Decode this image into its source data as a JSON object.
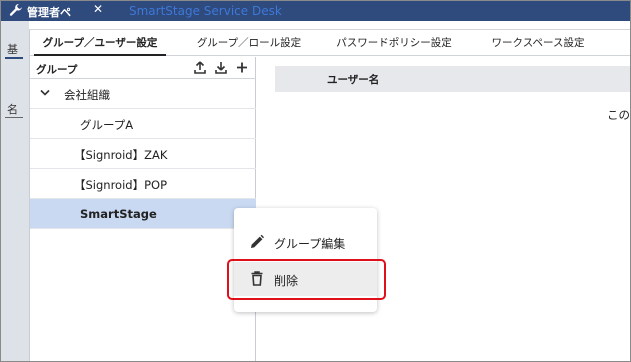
{
  "background": {
    "header_text": "管理者ペ",
    "app_title": "SmartStage Service Desk",
    "strip_labels": [
      "基",
      "名"
    ]
  },
  "tabs": [
    {
      "label": "グループ／ユーザー設定",
      "active": true
    },
    {
      "label": "グループ／ロール設定",
      "active": false
    },
    {
      "label": "パスワードポリシー設定",
      "active": false
    },
    {
      "label": "ワークスペース設定",
      "active": false
    }
  ],
  "group_panel": {
    "title": "グループ",
    "tree": [
      {
        "label": "会社組織",
        "expanded": true
      },
      {
        "label": "グループA"
      },
      {
        "label": "【Signroid】ZAK"
      },
      {
        "label": "【Signroid】POP"
      },
      {
        "label": "SmartStage",
        "selected": true
      }
    ]
  },
  "user_panel": {
    "column_header": "ユーザー名",
    "empty_text": "この"
  },
  "context_menu": {
    "edit_label": "グループ編集",
    "delete_label": "削除"
  },
  "colors": {
    "header_bg": "#2f4a7c",
    "selected_row": "#c9d9f2",
    "highlight": "#e0101a"
  }
}
